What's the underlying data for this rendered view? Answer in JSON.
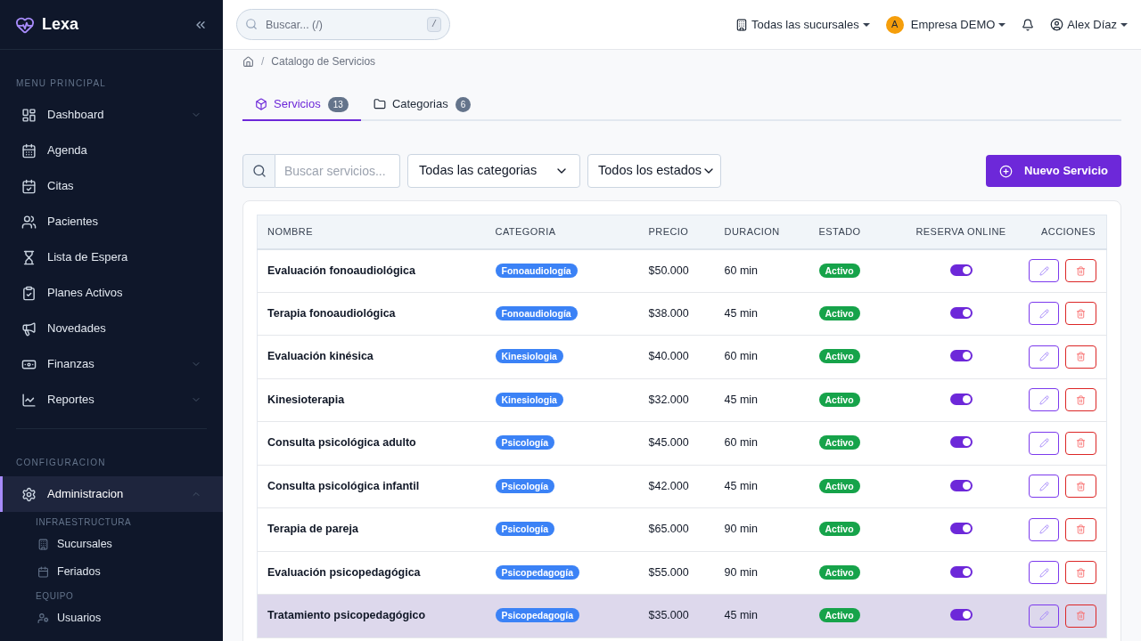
{
  "brand": {
    "name": "Lexa"
  },
  "sidebar": {
    "sections": [
      {
        "title": "MENU PRINCIPAL",
        "items": [
          {
            "label": "Dashboard",
            "kind": "group",
            "expanded": false,
            "selected": false
          },
          {
            "label": "Agenda",
            "kind": "link",
            "selected": false
          },
          {
            "label": "Citas",
            "kind": "link",
            "selected": false
          },
          {
            "label": "Pacientes",
            "kind": "link",
            "selected": false
          },
          {
            "label": "Lista de Espera",
            "kind": "link",
            "selected": false
          },
          {
            "label": "Planes Activos",
            "kind": "link",
            "selected": false
          },
          {
            "label": "Novedades",
            "kind": "link",
            "selected": false
          },
          {
            "label": "Finanzas",
            "kind": "group",
            "expanded": false,
            "selected": false
          },
          {
            "label": "Reportes",
            "kind": "group",
            "expanded": false,
            "selected": false
          }
        ]
      },
      {
        "title": "CONFIGURACION",
        "items": [
          {
            "label": "Administracion",
            "kind": "group",
            "expanded": true,
            "selected": true,
            "children": [
              {
                "kind": "heading",
                "label": "INFRAESTRUCTURA"
              },
              {
                "kind": "link",
                "label": "Sucursales"
              },
              {
                "kind": "link",
                "label": "Feriados"
              },
              {
                "kind": "heading",
                "label": "EQUIPO"
              },
              {
                "kind": "link",
                "label": "Usuarios"
              }
            ]
          }
        ]
      }
    ]
  },
  "topbar": {
    "search": {
      "placeholder": "Buscar... (/)",
      "shortcut": "/"
    },
    "branch": "Todas las sucursales",
    "company": {
      "initial": "A",
      "name": "Empresa DEMO"
    },
    "user": "Alex Díaz"
  },
  "breadcrumb": {
    "separator": "/",
    "items": [
      "Catalogo de Servicios"
    ]
  },
  "tabs": [
    {
      "label": "Servicios",
      "count": "13",
      "selected": true
    },
    {
      "label": "Categorias",
      "count": "6",
      "selected": false
    }
  ],
  "filters": {
    "search_placeholder": "Buscar servicios...",
    "category": "Todas las categorias",
    "status": "Todos los estados"
  },
  "new_button": "Nuevo Servicio",
  "table": {
    "columns": [
      "NOMBRE",
      "CATEGORIA",
      "PRECIO",
      "DURACION",
      "ESTADO",
      "RESERVA ONLINE",
      "ACCIONES"
    ],
    "rows": [
      {
        "name": "Evaluación fonoaudiológica",
        "category": "Fonoaudiología",
        "price": "$50.000",
        "duration": "60 min",
        "status": "Activo",
        "online": true,
        "selected": false
      },
      {
        "name": "Terapia fonoaudiológica",
        "category": "Fonoaudiología",
        "price": "$38.000",
        "duration": "45 min",
        "status": "Activo",
        "online": true,
        "selected": false
      },
      {
        "name": "Evaluación kinésica",
        "category": "Kinesiologia",
        "price": "$40.000",
        "duration": "60 min",
        "status": "Activo",
        "online": true,
        "selected": false
      },
      {
        "name": "Kinesioterapia",
        "category": "Kinesiologia",
        "price": "$32.000",
        "duration": "45 min",
        "status": "Activo",
        "online": true,
        "selected": false
      },
      {
        "name": "Consulta psicológica adulto",
        "category": "Psicología",
        "price": "$45.000",
        "duration": "60 min",
        "status": "Activo",
        "online": true,
        "selected": false
      },
      {
        "name": "Consulta psicológica infantil",
        "category": "Psicología",
        "price": "$42.000",
        "duration": "45 min",
        "status": "Activo",
        "online": true,
        "selected": false
      },
      {
        "name": "Terapia de pareja",
        "category": "Psicología",
        "price": "$65.000",
        "duration": "90 min",
        "status": "Activo",
        "online": true,
        "selected": false
      },
      {
        "name": "Evaluación psicopedagógica",
        "category": "Psicopedagogía",
        "price": "$55.000",
        "duration": "90 min",
        "status": "Activo",
        "online": true,
        "selected": false
      },
      {
        "name": "Tratamiento psicopedagógico",
        "category": "Psicopedagogía",
        "price": "$35.000",
        "duration": "45 min",
        "status": "Activo",
        "online": true,
        "selected": true
      }
    ]
  }
}
